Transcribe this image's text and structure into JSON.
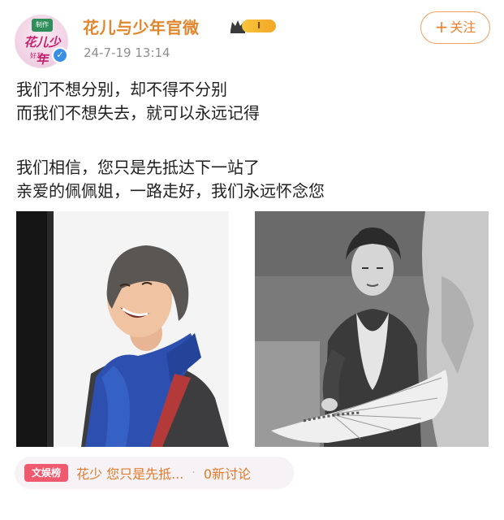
{
  "account": {
    "name": "花儿与少年官微",
    "level": "I",
    "timestamp": "24-7-19 13:14",
    "avatar_badge": "制作",
    "avatar_title": "花儿少年",
    "avatar_sub": "好友"
  },
  "follow_button": {
    "label": "关注",
    "plus": "+"
  },
  "post": {
    "lines": [
      "我们不想分别，却不得不分别",
      "而我们不想失去，就可以永远记得",
      "",
      "我们相信，您只是先抵达下一站了",
      "亲爱的佩佩姐，一路走好，我们永远怀念您"
    ]
  },
  "photos": [
    {
      "description": "smiling-woman-blue-scarf"
    },
    {
      "description": "bw-woman-with-fan"
    }
  ],
  "topic": {
    "tag": "文娱榜",
    "text": "花少 您只是先抵...",
    "count": "0新讨论"
  },
  "colors": {
    "username": "#e2862d",
    "follow": "#ea7f2e",
    "tag_bg": "#ef5a6f",
    "verified": "#3a8ee6"
  }
}
